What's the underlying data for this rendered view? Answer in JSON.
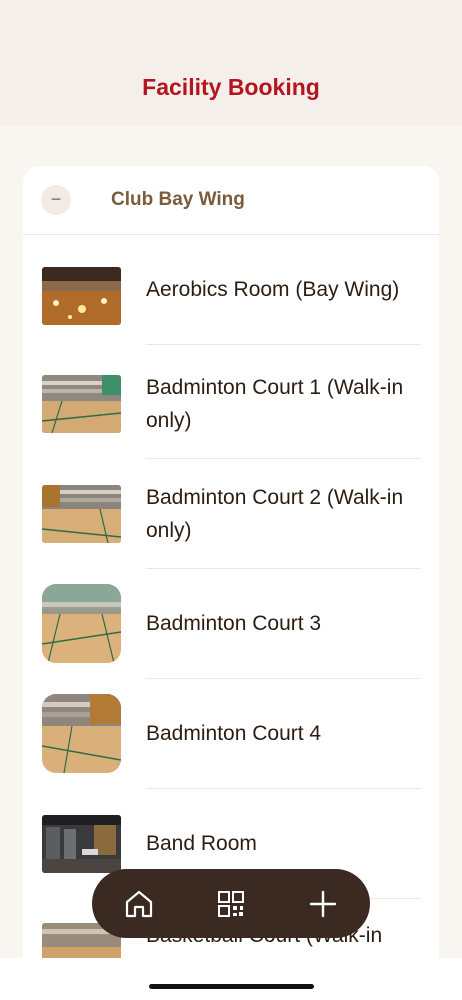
{
  "header": {
    "title": "Facility Booking"
  },
  "section": {
    "title": "Club Bay Wing",
    "collapse_symbol": "−"
  },
  "facilities": [
    {
      "name": "Aerobics Room (Bay Wing)"
    },
    {
      "name": "Badminton Court 1 (Walk-in only)"
    },
    {
      "name": "Badminton Court 2 (Walk-in only)"
    },
    {
      "name": "Badminton Court 3"
    },
    {
      "name": "Badminton Court 4"
    },
    {
      "name": "Band Room"
    },
    {
      "name": "Basketball Court (Walk-in"
    }
  ],
  "tabbar": {
    "items": [
      "home-icon",
      "qr-code-icon",
      "plus-icon"
    ]
  },
  "colors": {
    "accent": "#b3161e",
    "section": "#7a5c3c",
    "tabbar": "#3a2a22"
  }
}
